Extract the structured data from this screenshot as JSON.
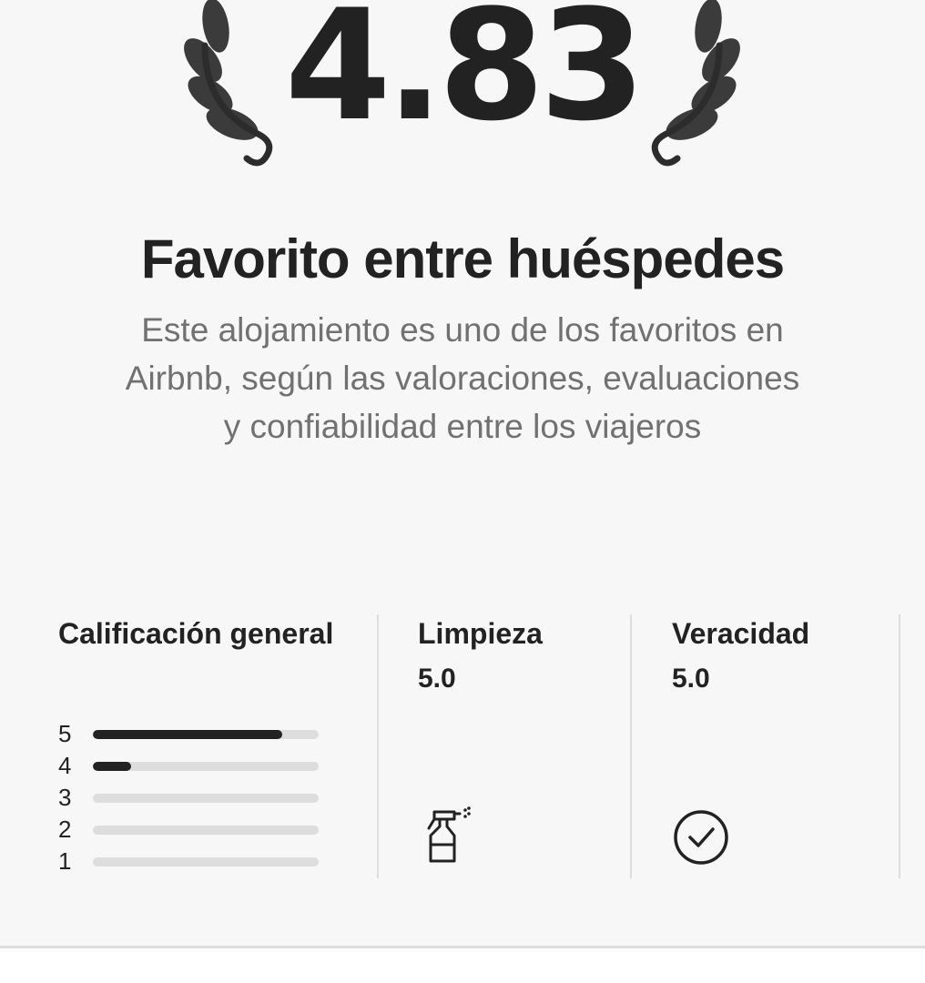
{
  "rating": {
    "value": "4.83"
  },
  "badge": {
    "title": "Favorito entre huéspedes",
    "description": "Este alojamiento es uno de los favoritos en Airbnb, según las valoraciones, evaluaciones y confiabilidad entre los viajeros"
  },
  "stats": {
    "overall": {
      "label": "Calificación general",
      "distribution": [
        {
          "stars": "5",
          "fraction": 0.84
        },
        {
          "stars": "4",
          "fraction": 0.17
        },
        {
          "stars": "3",
          "fraction": 0.0
        },
        {
          "stars": "2",
          "fraction": 0.0
        },
        {
          "stars": "1",
          "fraction": 0.0
        }
      ]
    },
    "cleanliness": {
      "label": "Limpieza",
      "value": "5.0",
      "icon": "spray-bottle-icon"
    },
    "accuracy": {
      "label": "Veracidad",
      "value": "5.0",
      "icon": "check-circle-icon"
    }
  },
  "colors": {
    "text_primary": "#222222",
    "text_secondary": "#717171",
    "bar_track": "#dddddd",
    "bar_fill": "#222222",
    "background": "#f7f7f7"
  }
}
